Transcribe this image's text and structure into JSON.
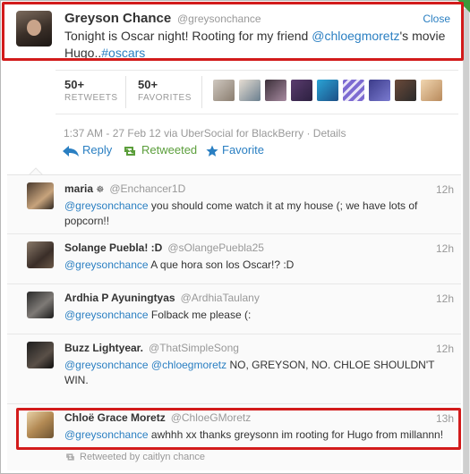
{
  "colors": {
    "link": "#2a7fc2",
    "retweeted": "#5b9e3b",
    "highlight": "#d21b1b",
    "muted": "#999999"
  },
  "main_tweet": {
    "name": "Greyson Chance",
    "handle": "@greysonchance",
    "close_label": "Close",
    "text_before": "Tonight is Oscar night! Rooting for my friend ",
    "mention": "@chloegmoretz",
    "text_after": "'s movie Hugo..",
    "hashtag": "#oscars",
    "retweets_count": "50+",
    "retweets_label": "RETWEETS",
    "favorites_count": "50+",
    "favorites_label": "FAVORITES",
    "timestamp": "1:37 AM - 27 Feb 12 via UberSocial for BlackBerry · Details",
    "actions": {
      "reply": "Reply",
      "retweeted": "Retweeted",
      "favorite": "Favorite"
    }
  },
  "replies": [
    {
      "name": "maria",
      "handle": "@Enchancer1D",
      "time": "12h",
      "mention": "@greysonchance",
      "text": " you should come watch it at my house (; we have lots of popcorn!!"
    },
    {
      "name": "Solange Puebla! :D",
      "handle": "@sOlangePuebla25",
      "time": "12h",
      "mention": "@greysonchance",
      "text": " A que hora son los Oscar!? :D"
    },
    {
      "name": "Ardhia P Ayuningtyas",
      "handle": "@ArdhiaTaulany",
      "time": "12h",
      "mention": "@greysonchance",
      "text": " Folback me please (:"
    },
    {
      "name": "Buzz Lightyear.",
      "handle": "@ThatSimpleSong",
      "time": "12h",
      "mention": "@greysonchance",
      "mention2": "@chloegmoretz",
      "text": " NO, GREYSON, NO. CHLOE SHOULDN'T WIN."
    },
    {
      "name": "Chloë Grace Moretz",
      "handle": "@ChloeGMoretz",
      "time": "13h",
      "mention": "@greysonchance",
      "text": " awhhh xx thanks greysonn im rooting for Hugo from millannn!",
      "retweeted_by": "Retweeted by caitlyn chance"
    }
  ]
}
